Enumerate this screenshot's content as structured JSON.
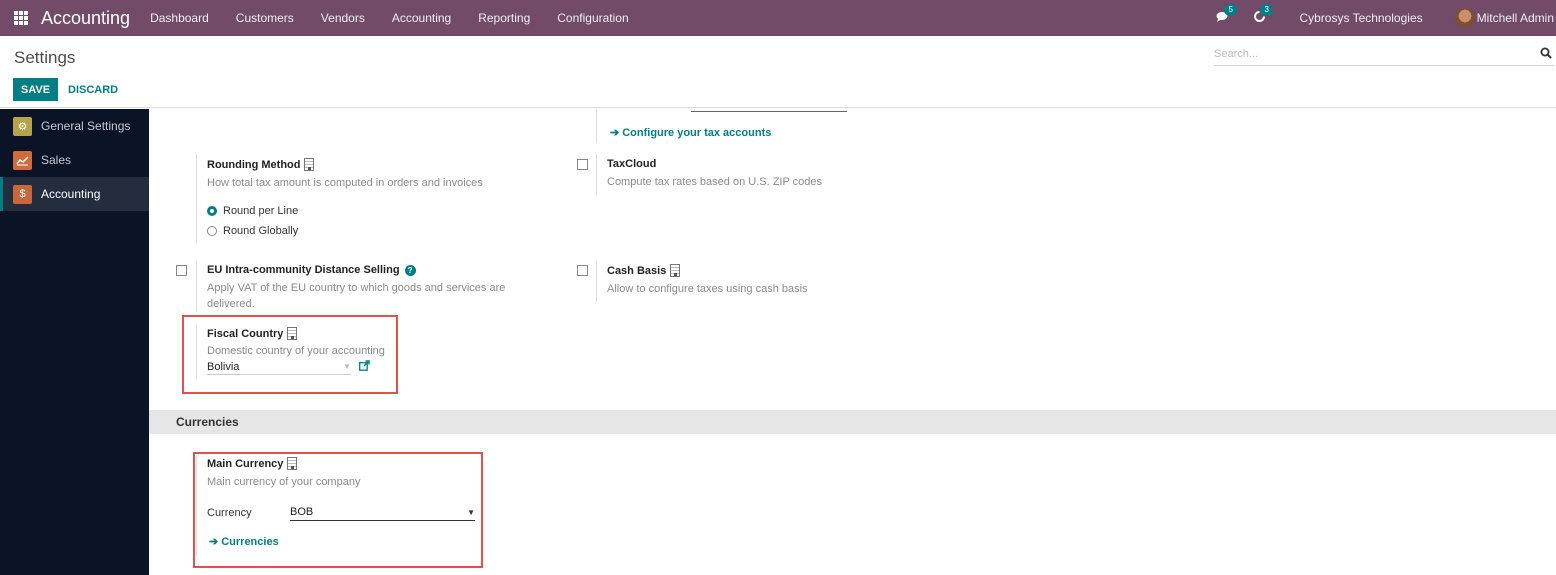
{
  "navbar": {
    "app_name": "Accounting",
    "menu": [
      "Dashboard",
      "Customers",
      "Vendors",
      "Accounting",
      "Reporting",
      "Configuration"
    ],
    "messages_count": "5",
    "activities_count": "3",
    "company": "Cybrosys Technologies",
    "user": "Mitchell Admin"
  },
  "control_panel": {
    "title": "Settings",
    "save_label": "SAVE",
    "discard_label": "DISCARD",
    "search_placeholder": "Search..."
  },
  "sidebar": {
    "items": [
      {
        "label": "General Settings",
        "color": "#b8a349",
        "active": false
      },
      {
        "label": "Sales",
        "color": "#d16b3d",
        "active": false
      },
      {
        "label": "Accounting",
        "color": "#c8663c",
        "active": true
      }
    ]
  },
  "settings": {
    "configure_tax_accounts": "Configure your tax accounts",
    "rounding": {
      "title": "Rounding Method",
      "desc": "How total tax amount is computed in orders and invoices",
      "options": [
        "Round per Line",
        "Round Globally"
      ],
      "selected": "Round per Line"
    },
    "taxcloud": {
      "title": "TaxCloud",
      "desc": "Compute tax rates based on U.S. ZIP codes",
      "checked": false
    },
    "eu_distance": {
      "title": "EU Intra-community Distance Selling",
      "desc": "Apply VAT of the EU country to which goods and services are delivered.",
      "checked": false
    },
    "cash_basis": {
      "title": "Cash Basis",
      "desc": "Allow to configure taxes using cash basis",
      "checked": false
    },
    "fiscal_country": {
      "title": "Fiscal Country",
      "desc": "Domestic country of your accounting",
      "value": "Bolivia"
    }
  },
  "currencies": {
    "section_title": "Currencies",
    "main_currency_title": "Main Currency",
    "main_currency_desc": "Main currency of your company",
    "currency_label": "Currency",
    "currency_value": "BOB",
    "currencies_link": "Currencies"
  },
  "colors": {
    "brand": "#714b67",
    "accent": "#017e84",
    "highlight": "#e3514c"
  }
}
